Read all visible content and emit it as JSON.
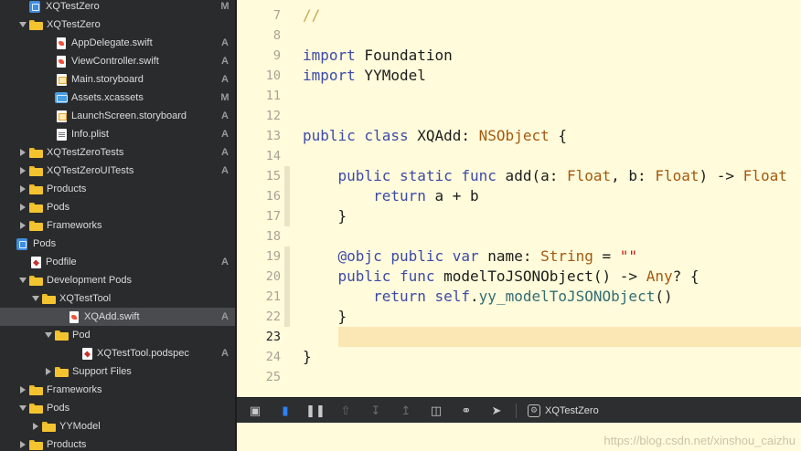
{
  "navigator": {
    "rows": [
      {
        "label": "XQTestZero",
        "badge": "M",
        "depth": 0,
        "icon": "project-icon",
        "disclosure": "none"
      },
      {
        "label": "XQTestZero",
        "badge": "",
        "depth": 0,
        "icon": "folder-icon",
        "disclosure": "open"
      },
      {
        "label": "AppDelegate.swift",
        "badge": "A",
        "depth": 2,
        "icon": "swift-file-icon",
        "disclosure": "none"
      },
      {
        "label": "ViewController.swift",
        "badge": "A",
        "depth": 2,
        "icon": "swift-file-icon",
        "disclosure": "none"
      },
      {
        "label": "Main.storyboard",
        "badge": "A",
        "depth": 2,
        "icon": "storyboard-icon",
        "disclosure": "none"
      },
      {
        "label": "Assets.xcassets",
        "badge": "M",
        "depth": 2,
        "icon": "assets-icon",
        "disclosure": "none"
      },
      {
        "label": "LaunchScreen.storyboard",
        "badge": "A",
        "depth": 2,
        "icon": "storyboard-icon",
        "disclosure": "none"
      },
      {
        "label": "Info.plist",
        "badge": "A",
        "depth": 2,
        "icon": "plist-icon",
        "disclosure": "none"
      },
      {
        "label": "XQTestZeroTests",
        "badge": "A",
        "depth": 0,
        "icon": "folder-icon",
        "disclosure": "closed"
      },
      {
        "label": "XQTestZeroUITests",
        "badge": "A",
        "depth": 0,
        "icon": "folder-icon",
        "disclosure": "closed"
      },
      {
        "label": "Products",
        "badge": "",
        "depth": 0,
        "icon": "folder-icon",
        "disclosure": "closed"
      },
      {
        "label": "Pods",
        "badge": "",
        "depth": 0,
        "icon": "folder-icon",
        "disclosure": "closed"
      },
      {
        "label": "Frameworks",
        "badge": "",
        "depth": 0,
        "icon": "folder-icon",
        "disclosure": "closed"
      },
      {
        "label": "Pods",
        "badge": "",
        "depth": -1,
        "icon": "project-icon",
        "disclosure": "none"
      },
      {
        "label": "Podfile",
        "badge": "A",
        "depth": 0,
        "icon": "ruby-file-icon",
        "disclosure": "none"
      },
      {
        "label": "Development Pods",
        "badge": "",
        "depth": 0,
        "icon": "folder-icon",
        "disclosure": "open"
      },
      {
        "label": "XQTestTool",
        "badge": "",
        "depth": 1,
        "icon": "folder-icon",
        "disclosure": "open"
      },
      {
        "label": "XQAdd.swift",
        "badge": "A",
        "depth": 3,
        "icon": "swift-file-icon",
        "disclosure": "none",
        "selected": true
      },
      {
        "label": "Pod",
        "badge": "",
        "depth": 2,
        "icon": "folder-icon",
        "disclosure": "open"
      },
      {
        "label": "XQTestTool.podspec",
        "badge": "A",
        "depth": 4,
        "icon": "ruby-file-icon",
        "disclosure": "none"
      },
      {
        "label": "Support Files",
        "badge": "",
        "depth": 2,
        "icon": "folder-icon",
        "disclosure": "closed"
      },
      {
        "label": "Frameworks",
        "badge": "",
        "depth": 0,
        "icon": "folder-icon",
        "disclosure": "closed"
      },
      {
        "label": "Pods",
        "badge": "",
        "depth": 0,
        "icon": "folder-icon",
        "disclosure": "open"
      },
      {
        "label": "YYModel",
        "badge": "",
        "depth": 1,
        "icon": "folder-icon",
        "disclosure": "closed"
      },
      {
        "label": "Products",
        "badge": "",
        "depth": 0,
        "icon": "folder-icon",
        "disclosure": "closed"
      }
    ]
  },
  "editor": {
    "current_line": 23,
    "lines": [
      {
        "num": "7",
        "tokens": [
          {
            "t": "//",
            "c": "cm"
          }
        ]
      },
      {
        "num": "8",
        "tokens": []
      },
      {
        "num": "9",
        "tokens": [
          {
            "t": "import",
            "c": "kw"
          },
          {
            "t": " Foundation",
            "c": ""
          }
        ]
      },
      {
        "num": "10",
        "tokens": [
          {
            "t": "import",
            "c": "kw"
          },
          {
            "t": " YYModel",
            "c": ""
          }
        ]
      },
      {
        "num": "11",
        "tokens": []
      },
      {
        "num": "12",
        "tokens": []
      },
      {
        "num": "13",
        "tokens": [
          {
            "t": "public class",
            "c": "kw"
          },
          {
            "t": " XQAdd: ",
            "c": ""
          },
          {
            "t": "NSObject",
            "c": "ty"
          },
          {
            "t": " {",
            "c": ""
          }
        ]
      },
      {
        "num": "14",
        "tokens": []
      },
      {
        "num": "15",
        "tokens": [
          {
            "t": "    public static func",
            "c": "kw"
          },
          {
            "t": " add(a: ",
            "c": ""
          },
          {
            "t": "Float",
            "c": "ty"
          },
          {
            "t": ", b: ",
            "c": ""
          },
          {
            "t": "Float",
            "c": "ty"
          },
          {
            "t": ") -> ",
            "c": ""
          },
          {
            "t": "Float",
            "c": "ty"
          }
        ]
      },
      {
        "num": "16",
        "tokens": [
          {
            "t": "        return",
            "c": "kw"
          },
          {
            "t": " a + b",
            "c": ""
          }
        ]
      },
      {
        "num": "17",
        "tokens": [
          {
            "t": "    }",
            "c": ""
          }
        ]
      },
      {
        "num": "18",
        "tokens": []
      },
      {
        "num": "19",
        "tokens": [
          {
            "t": "    @objc public var",
            "c": "kw"
          },
          {
            "t": " name: ",
            "c": ""
          },
          {
            "t": "String",
            "c": "ty"
          },
          {
            "t": " = ",
            "c": ""
          },
          {
            "t": "\"\"",
            "c": "st"
          }
        ]
      },
      {
        "num": "20",
        "tokens": [
          {
            "t": "    public func",
            "c": "kw"
          },
          {
            "t": " modelToJSONObject() -> ",
            "c": ""
          },
          {
            "t": "Any",
            "c": "ty"
          },
          {
            "t": "? {",
            "c": ""
          }
        ]
      },
      {
        "num": "21",
        "tokens": [
          {
            "t": "        return self",
            "c": "kw"
          },
          {
            "t": ".",
            "c": ""
          },
          {
            "t": "yy_modelToJSONObject",
            "c": "fn"
          },
          {
            "t": "()",
            "c": ""
          }
        ]
      },
      {
        "num": "22",
        "tokens": [
          {
            "t": "    }",
            "c": ""
          }
        ]
      },
      {
        "num": "23",
        "tokens": []
      },
      {
        "num": "24",
        "tokens": [
          {
            "t": "}",
            "c": ""
          }
        ]
      },
      {
        "num": "25",
        "tokens": []
      }
    ]
  },
  "debugbar": {
    "scheme_name": "XQTestZero"
  },
  "watermark": "https://blog.csdn.net/xinshou_caizhu",
  "colors": {
    "editor_bg": "#fffbdb",
    "navigator_bg": "#2a2b2d",
    "keyword": "#3c4aa9",
    "type": "#a4590f",
    "accent_blue": "#2f7ff6"
  }
}
